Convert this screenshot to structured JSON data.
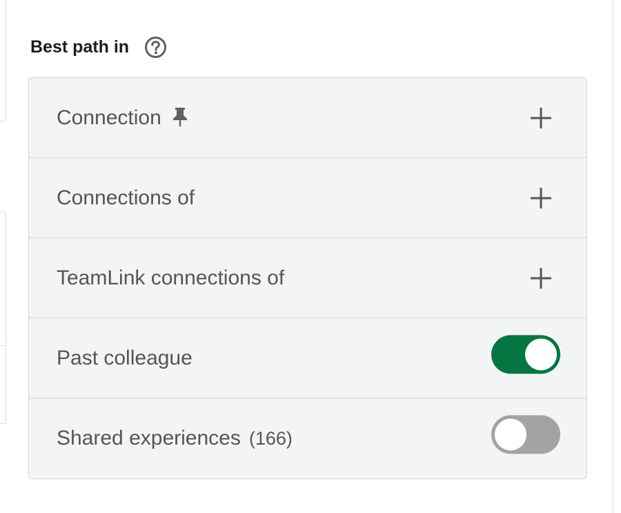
{
  "section": {
    "title": "Best path in",
    "help_icon": "question-circle-icon"
  },
  "filters": [
    {
      "label": "Connection",
      "icon": "pin-icon",
      "control": "add"
    },
    {
      "label": "Connections of",
      "control": "add"
    },
    {
      "label": "TeamLink connections of",
      "control": "add"
    },
    {
      "label": "Past colleague",
      "control": "toggle",
      "enabled": true
    },
    {
      "label": "Shared experiences",
      "count": "(166)",
      "control": "toggle",
      "enabled": false
    }
  ],
  "colors": {
    "toggle_on": "#057642",
    "toggle_off": "#a3a3a3",
    "card_bg": "#f3f4f6",
    "label_text": "#555555"
  }
}
